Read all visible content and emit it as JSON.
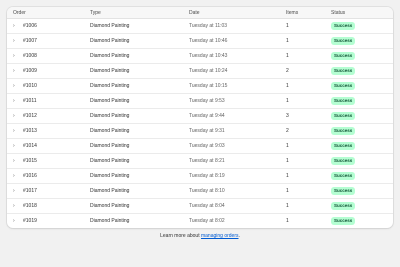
{
  "table": {
    "headers": {
      "order": "Order",
      "type": "Type",
      "date": "Date",
      "items": "Items",
      "status": "Status"
    },
    "rows": [
      {
        "order": "#1006",
        "type": "Diamond Painting",
        "date": "Tuesday at 11:03",
        "items": "1",
        "status": "Success"
      },
      {
        "order": "#1007",
        "type": "Diamond Painting",
        "date": "Tuesday at 10:46",
        "items": "1",
        "status": "Success"
      },
      {
        "order": "#1008",
        "type": "Diamond Painting",
        "date": "Tuesday at 10:43",
        "items": "1",
        "status": "Success"
      },
      {
        "order": "#1009",
        "type": "Diamond Painting",
        "date": "Tuesday at 10:24",
        "items": "2",
        "status": "Success"
      },
      {
        "order": "#1010",
        "type": "Diamond Painting",
        "date": "Tuesday at 10:15",
        "items": "1",
        "status": "Success"
      },
      {
        "order": "#1011",
        "type": "Diamond Painting",
        "date": "Tuesday at 9:53",
        "items": "1",
        "status": "Success"
      },
      {
        "order": "#1012",
        "type": "Diamond Painting",
        "date": "Tuesday at 9:44",
        "items": "3",
        "status": "Success"
      },
      {
        "order": "#1013",
        "type": "Diamond Painting",
        "date": "Tuesday at 9:31",
        "items": "2",
        "status": "Success"
      },
      {
        "order": "#1014",
        "type": "Diamond Painting",
        "date": "Tuesday at 9:03",
        "items": "1",
        "status": "Success"
      },
      {
        "order": "#1015",
        "type": "Diamond Painting",
        "date": "Tuesday at 8:21",
        "items": "1",
        "status": "Success"
      },
      {
        "order": "#1016",
        "type": "Diamond Painting",
        "date": "Tuesday at 8:19",
        "items": "1",
        "status": "Success"
      },
      {
        "order": "#1017",
        "type": "Diamond Painting",
        "date": "Tuesday at 8:10",
        "items": "1",
        "status": "Success"
      },
      {
        "order": "#1018",
        "type": "Diamond Painting",
        "date": "Tuesday at 8:04",
        "items": "1",
        "status": "Success"
      },
      {
        "order": "#1019",
        "type": "Diamond Painting",
        "date": "Tuesday at 8:02",
        "items": "1",
        "status": "Success"
      }
    ]
  },
  "icons": {
    "row_expand": "chevron-right-icon",
    "row_expand_glyph": "›"
  },
  "colors": {
    "success_badge_bg": "#b4fed2",
    "success_badge_text": "#0c5132",
    "link": "#005bd3"
  },
  "footer": {
    "prefix": "Learn more about ",
    "link_text": "managing orders",
    "suffix": "."
  }
}
